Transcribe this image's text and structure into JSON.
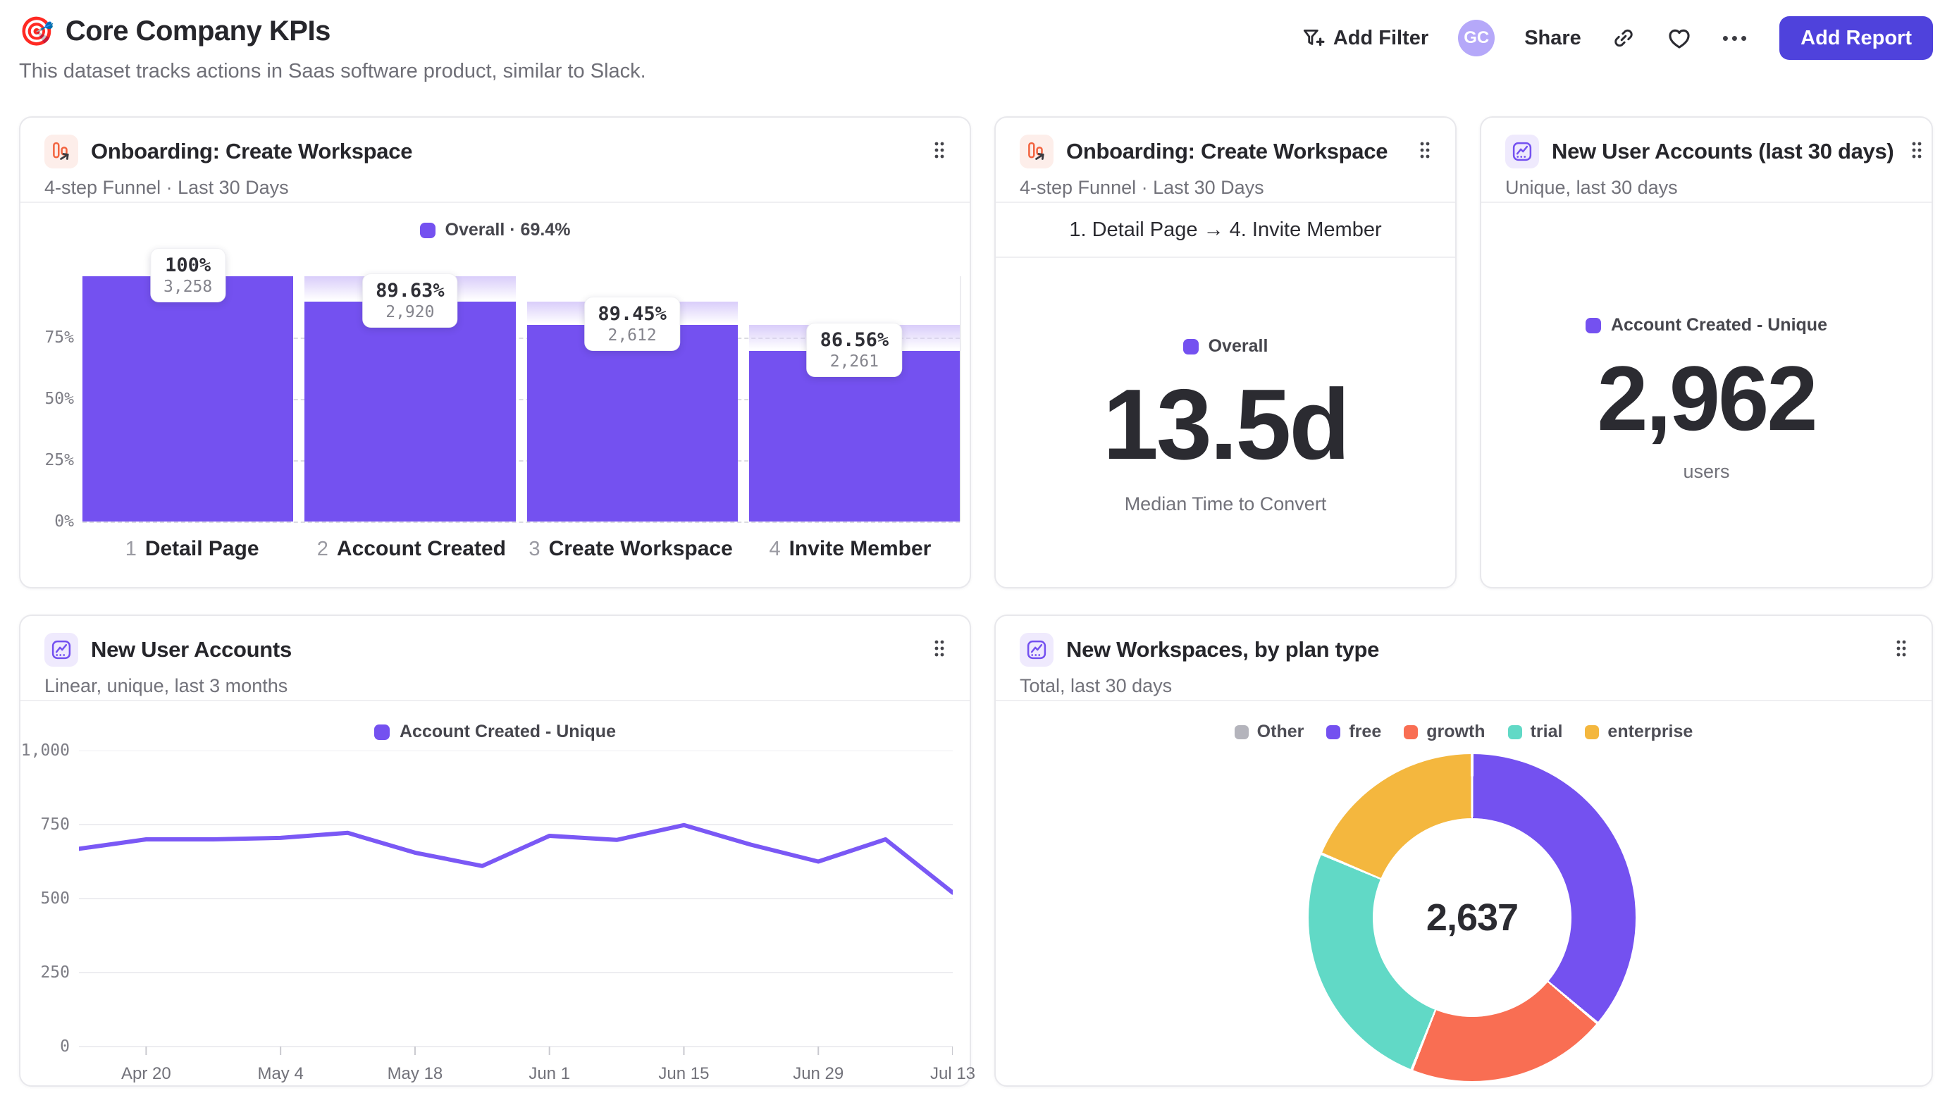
{
  "page": {
    "emoji": "🎯",
    "title": "Core Company KPIs",
    "subtitle": "This dataset tracks actions in Saas software product, similar to Slack."
  },
  "toolbar": {
    "add_filter": "Add Filter",
    "avatar_initials": "GC",
    "share": "Share",
    "more": "•••",
    "add_report": "Add Report"
  },
  "colors": {
    "accent_purple": "#7451f0",
    "line_purple": "#7a58f5",
    "button_indigo": "#4f42dc",
    "coral": "#f96e53",
    "teal": "#61d9c6",
    "yellow": "#f4b73e",
    "gray_chip": "#b4b4bc",
    "funnel_icon_red": "#f2633f"
  },
  "cards": {
    "funnel": {
      "title": "Onboarding: Create Workspace",
      "subtitle": "4-step Funnel · Last 30 Days",
      "legend": "Overall · 69.4%",
      "chart_data": {
        "type": "funnel-bar",
        "title": "Onboarding: Create Workspace",
        "overall_conversion": "69.4%",
        "y_ticks": [
          75,
          50,
          25,
          0
        ],
        "grid": "dashed",
        "steps": [
          {
            "num": "1",
            "name": "Detail Page",
            "pct": "100%",
            "count": "3,258",
            "cum": 100,
            "prev": 100
          },
          {
            "num": "2",
            "name": "Account Created",
            "pct": "89.63%",
            "count": "2,920",
            "cum": 89.63,
            "prev": 100
          },
          {
            "num": "3",
            "name": "Create Workspace",
            "pct": "89.45%",
            "count": "2,612",
            "cum": 80.17,
            "prev": 89.63
          },
          {
            "num": "4",
            "name": "Invite Member",
            "pct": "86.56%",
            "count": "2,261",
            "cum": 69.4,
            "prev": 80.17
          }
        ]
      }
    },
    "time_to_convert": {
      "title": "Onboarding: Create Workspace",
      "subtitle": "4-step Funnel · Last 30 Days",
      "range_label": "1. Detail Page → 4. Invite Member",
      "legend": "Overall",
      "value": "13.5d",
      "caption": "Median Time to Convert"
    },
    "new_accounts_30d": {
      "title": "New User Accounts (last 30 days)",
      "subtitle": "Unique, last 30 days",
      "legend": "Account Created - Unique",
      "value": "2,962",
      "caption": "users"
    },
    "accounts_trend": {
      "title": "New User Accounts",
      "subtitle": "Linear, unique, last 3 months",
      "legend": "Account Created - Unique",
      "chart_data": {
        "type": "line",
        "series": [
          {
            "name": "Account Created - Unique",
            "values": [
              668,
              700,
              700,
              705,
              722,
              655,
              610,
              712,
              698,
              748,
              682,
              625,
              700,
              520
            ]
          }
        ],
        "n_points": 14,
        "point_interval": "weekly",
        "x_ticks": [
          {
            "label": "Apr 20",
            "index": 1
          },
          {
            "label": "May 4",
            "index": 3
          },
          {
            "label": "May 18",
            "index": 5
          },
          {
            "label": "Jun 1",
            "index": 7
          },
          {
            "label": "Jun 15",
            "index": 9
          },
          {
            "label": "Jun 29",
            "index": 11
          },
          {
            "label": "Jul 13",
            "index": 13
          }
        ],
        "y_ticks": [
          0,
          250,
          500,
          750,
          1000
        ],
        "ylim": [
          0,
          1000
        ],
        "grid": "horizontal"
      }
    },
    "workspaces_by_plan": {
      "title": "New Workspaces, by plan type",
      "subtitle": "Total, last 30 days",
      "total": "2,637",
      "chart_data": {
        "type": "donut",
        "title": "New Workspaces, by plan type",
        "total": 2637,
        "legend_position": "top",
        "series": [
          {
            "name": "Other",
            "value": 0,
            "color": "#b4b4bc"
          },
          {
            "name": "free",
            "value": 953,
            "color": "#7451f0"
          },
          {
            "name": "growth",
            "value": 524,
            "color": "#f96e53"
          },
          {
            "name": "trial",
            "value": 669,
            "color": "#61d9c6"
          },
          {
            "name": "enterprise",
            "value": 491,
            "color": "#f4b73e"
          }
        ]
      }
    }
  }
}
